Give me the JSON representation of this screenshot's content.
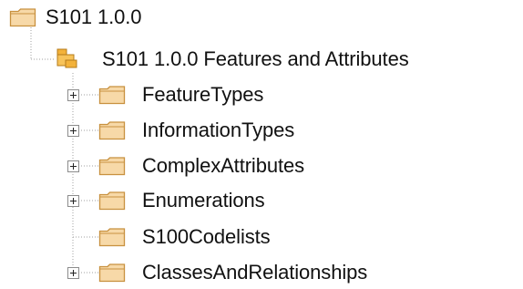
{
  "tree": {
    "root": {
      "label": "S101 1.0.0",
      "icon": "folder-icon"
    },
    "package": {
      "label": "S101 1.0.0 Features and Attributes",
      "icon": "package-icon"
    },
    "children": [
      {
        "label": "FeatureTypes",
        "icon": "folder-icon",
        "expandable": true
      },
      {
        "label": "InformationTypes",
        "icon": "folder-icon",
        "expandable": true
      },
      {
        "label": "ComplexAttributes",
        "icon": "folder-icon",
        "expandable": true
      },
      {
        "label": "Enumerations",
        "icon": "folder-icon",
        "expandable": true
      },
      {
        "label": "S100Codelists",
        "icon": "folder-icon",
        "expandable": false
      },
      {
        "label": "ClassesAndRelationships",
        "icon": "folder-icon",
        "expandable": true
      }
    ]
  },
  "colors": {
    "folder_fill": "#F7D9A8",
    "folder_stroke": "#C8913F",
    "package_fill": "#F3B23A",
    "text": "#111111",
    "tree_lines": "#A0A0A0"
  }
}
